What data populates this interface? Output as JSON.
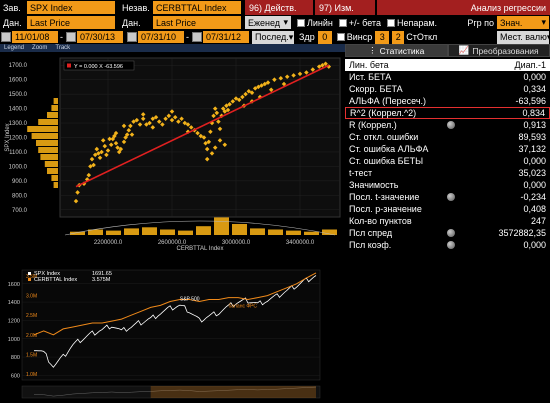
{
  "toolbar": {
    "row1": {
      "ind_label": "Зав.",
      "ind_value": "SPX Index",
      "dep_label": "Незав.",
      "dep_value": "CERBTTAL Index",
      "actions_btn": "96) Действ.",
      "edit_btn": "97) Изм.",
      "analysis_title": "Анализ регрессии"
    },
    "row2": {
      "dan1_label": "Дан.",
      "dan1_value": "Last Price",
      "dan2_label": "Дан.",
      "dan2_value": "Last Price",
      "freq_value": "Еженед",
      "linear_label": "Линйн",
      "beta_label": "+/- бета",
      "nonpar_label": "Непарам.",
      "rgr_label": "Ргр по",
      "rgr_value": "Знач."
    },
    "row3": {
      "date1_from": "11/01/08",
      "date1_to": "07/30/13",
      "date2_from": "07/31/10",
      "date2_to": "07/31/12",
      "last_value": "Послед.",
      "zdr_label": "Здр",
      "zdr_value": "0",
      "vinsr_label": "Винср",
      "vinsr_value": "3",
      "stotkl_value": "2",
      "stotkl_label": "СтОткл",
      "local_value": "Мест. валю"
    }
  },
  "plot": {
    "subtabs": [
      "Legend",
      "Zoom",
      "Track"
    ],
    "legend_text": "Y = 0.000 X -63.596",
    "y_axis_label": "SPX Index",
    "x_axis_label": "CERBTTAL Index",
    "bottom_legend": [
      {
        "name": "SPX Index",
        "value": "1691.65"
      },
      {
        "name": "CERBTTAL Index",
        "value": "3.575M"
      }
    ],
    "annotation_spx": "S&P 500",
    "annotation_cb": "баланс ФРС",
    "colors": {
      "scatter": "#f2b21a",
      "fit": "#e02020",
      "spx": "#ffffff",
      "cb": "#f08a1a"
    }
  },
  "chart_data": [
    {
      "type": "scatter",
      "xlabel": "CERBTTAL Index",
      "ylabel": "SPX Index",
      "x_ticks": [
        "2200000.0",
        "2600000.0",
        "3000000.0",
        "3400000.0"
      ],
      "y_ticks": [
        "700.0",
        "800.0",
        "900.0",
        "1000.0",
        "1100.0",
        "1200.0",
        "1300.0",
        "1400.0",
        "1500.0",
        "1600.0",
        "1700.0"
      ],
      "xlim": [
        1900000,
        3650000
      ],
      "ylim": [
        650,
        1750
      ],
      "fit": {
        "slope_label": "0.000",
        "intercept": -63.596,
        "from": [
          2000000,
          860
        ],
        "to": [
          3580000,
          1700
        ]
      },
      "points": [
        [
          2000000,
          760
        ],
        [
          2010000,
          820
        ],
        [
          2020000,
          870
        ],
        [
          2050000,
          880
        ],
        [
          2070000,
          910
        ],
        [
          2080000,
          940
        ],
        [
          2090000,
          1000
        ],
        [
          2100000,
          1050
        ],
        [
          2110000,
          1010
        ],
        [
          2120000,
          1080
        ],
        [
          2130000,
          1120
        ],
        [
          2140000,
          1090
        ],
        [
          2150000,
          1060
        ],
        [
          2160000,
          1100
        ],
        [
          2170000,
          1180
        ],
        [
          2180000,
          1140
        ],
        [
          2190000,
          1080
        ],
        [
          2200000,
          1110
        ],
        [
          2210000,
          1190
        ],
        [
          2220000,
          1150
        ],
        [
          2230000,
          1190
        ],
        [
          2240000,
          1210
        ],
        [
          2250000,
          1160
        ],
        [
          2260000,
          1130
        ],
        [
          2270000,
          1100
        ],
        [
          2280000,
          1120
        ],
        [
          2300000,
          1170
        ],
        [
          2310000,
          1200
        ],
        [
          2320000,
          1220
        ],
        [
          2330000,
          1250
        ],
        [
          2340000,
          1280
        ],
        [
          2360000,
          1310
        ],
        [
          2380000,
          1320
        ],
        [
          2400000,
          1290
        ],
        [
          2420000,
          1330
        ],
        [
          2440000,
          1290
        ],
        [
          2460000,
          1300
        ],
        [
          2480000,
          1330
        ],
        [
          2500000,
          1340
        ],
        [
          2520000,
          1310
        ],
        [
          2540000,
          1290
        ],
        [
          2560000,
          1330
        ],
        [
          2580000,
          1350
        ],
        [
          2600000,
          1320
        ],
        [
          2620000,
          1340
        ],
        [
          2640000,
          1310
        ],
        [
          2660000,
          1330
        ],
        [
          2680000,
          1300
        ],
        [
          2700000,
          1290
        ],
        [
          2720000,
          1270
        ],
        [
          2740000,
          1250
        ],
        [
          2760000,
          1230
        ],
        [
          2780000,
          1210
        ],
        [
          2800000,
          1200
        ],
        [
          2810000,
          1160
        ],
        [
          2820000,
          1120
        ],
        [
          2830000,
          1170
        ],
        [
          2840000,
          1240
        ],
        [
          2850000,
          1300
        ],
        [
          2860000,
          1350
        ],
        [
          2870000,
          1400
        ],
        [
          2880000,
          1370
        ],
        [
          2890000,
          1310
        ],
        [
          2900000,
          1260
        ],
        [
          2910000,
          1350
        ],
        [
          2920000,
          1400
        ],
        [
          2930000,
          1380
        ],
        [
          2940000,
          1420
        ],
        [
          2950000,
          1390
        ],
        [
          2960000,
          1430
        ],
        [
          2980000,
          1450
        ],
        [
          3000000,
          1470
        ],
        [
          3020000,
          1460
        ],
        [
          3040000,
          1480
        ],
        [
          3060000,
          1500
        ],
        [
          3080000,
          1520
        ],
        [
          3100000,
          1510
        ],
        [
          3120000,
          1540
        ],
        [
          3140000,
          1550
        ],
        [
          3160000,
          1560
        ],
        [
          3180000,
          1570
        ],
        [
          3200000,
          1580
        ],
        [
          3240000,
          1600
        ],
        [
          3280000,
          1610
        ],
        [
          3320000,
          1620
        ],
        [
          3360000,
          1630
        ],
        [
          3400000,
          1640
        ],
        [
          3440000,
          1650
        ],
        [
          3480000,
          1670
        ],
        [
          3520000,
          1690
        ],
        [
          3540000,
          1700
        ],
        [
          3560000,
          1710
        ],
        [
          3580000,
          1690
        ],
        [
          2250000,
          1230
        ],
        [
          2300000,
          1280
        ],
        [
          2350000,
          1220
        ],
        [
          2420000,
          1360
        ],
        [
          2480000,
          1270
        ],
        [
          2600000,
          1380
        ],
        [
          2700000,
          1240
        ],
        [
          2820000,
          1050
        ],
        [
          2850000,
          1090
        ],
        [
          2870000,
          1130
        ],
        [
          2900000,
          1180
        ],
        [
          2930000,
          1150
        ],
        [
          3050000,
          1420
        ],
        [
          3100000,
          1450
        ],
        [
          3150000,
          1480
        ],
        [
          3220000,
          1530
        ],
        [
          3300000,
          1570
        ]
      ]
    },
    {
      "type": "line",
      "xlabel": "",
      "ylabel": "",
      "y_ticks": [
        "600",
        "800",
        "1000",
        "1200",
        "1400",
        "1600"
      ],
      "ylim": [
        550,
        1750
      ],
      "right_ticks": [
        "1.0M",
        "1.5M",
        "2.0M",
        "2.5M",
        "3.0M",
        "3.5M"
      ],
      "series": [
        {
          "name": "SPX Index",
          "values": [
            900,
            850,
            700,
            800,
            930,
            1000,
            1060,
            1100,
            1150,
            1080,
            1130,
            1180,
            1220,
            1280,
            1330,
            1360,
            1300,
            1200,
            1250,
            1290,
            1350,
            1400,
            1420,
            1380,
            1420,
            1460,
            1520,
            1580,
            1640,
            1690
          ]
        },
        {
          "name": "CERBTTAL Index",
          "values": [
            2.0,
            2.1,
            2.0,
            2.15,
            2.2,
            2.25,
            2.3,
            2.3,
            2.35,
            2.4,
            2.5,
            2.6,
            2.7,
            2.75,
            2.85,
            2.9,
            2.9,
            2.85,
            2.9,
            2.9,
            2.95,
            2.95,
            2.9,
            2.95,
            3.0,
            3.1,
            3.2,
            3.3,
            3.45,
            3.58
          ]
        }
      ]
    }
  ],
  "right": {
    "tabs": [
      "Статистика",
      "Преобразования"
    ],
    "header": {
      "key": "Лин. бета",
      "value": "Диап.-1"
    },
    "rows": [
      {
        "key": "Ист. БЕТА",
        "value": "0,000",
        "dot": false,
        "highlight": false
      },
      {
        "key": "Скорр. БЕТА",
        "value": "0,334",
        "dot": false,
        "highlight": false
      },
      {
        "key": "АЛЬФА (Пересеч.)",
        "value": "-63,596",
        "dot": false,
        "highlight": false
      },
      {
        "key": "R^2 (Коррел.^2)",
        "value": "0,834",
        "dot": false,
        "highlight": true
      },
      {
        "key": "R (Коррел.)",
        "value": "0,913",
        "dot": true,
        "highlight": false
      },
      {
        "key": "Ст. откл. ошибки",
        "value": "89,593",
        "dot": false,
        "highlight": false
      },
      {
        "key": "Ст. ошибка АЛЬФА",
        "value": "37,132",
        "dot": false,
        "highlight": false
      },
      {
        "key": "Ст. ошибка БЕТЫ",
        "value": "0,000",
        "dot": false,
        "highlight": false
      },
      {
        "key": "t-тест",
        "value": "35,023",
        "dot": false,
        "highlight": false
      },
      {
        "key": "Значимость",
        "value": "0,000",
        "dot": false,
        "highlight": false
      },
      {
        "key": "Посл. t-значение",
        "value": "-0,234",
        "dot": true,
        "highlight": false
      },
      {
        "key": "Посл. p-значение",
        "value": "0,408",
        "dot": false,
        "highlight": false
      },
      {
        "key": "Кол-во пунктов",
        "value": "247",
        "dot": false,
        "highlight": false
      },
      {
        "key": "Псл спред",
        "value": "3572882,35",
        "dot": true,
        "highlight": false
      },
      {
        "key": "Псл коэф.",
        "value": "0,000",
        "dot": true,
        "highlight": false
      }
    ]
  }
}
